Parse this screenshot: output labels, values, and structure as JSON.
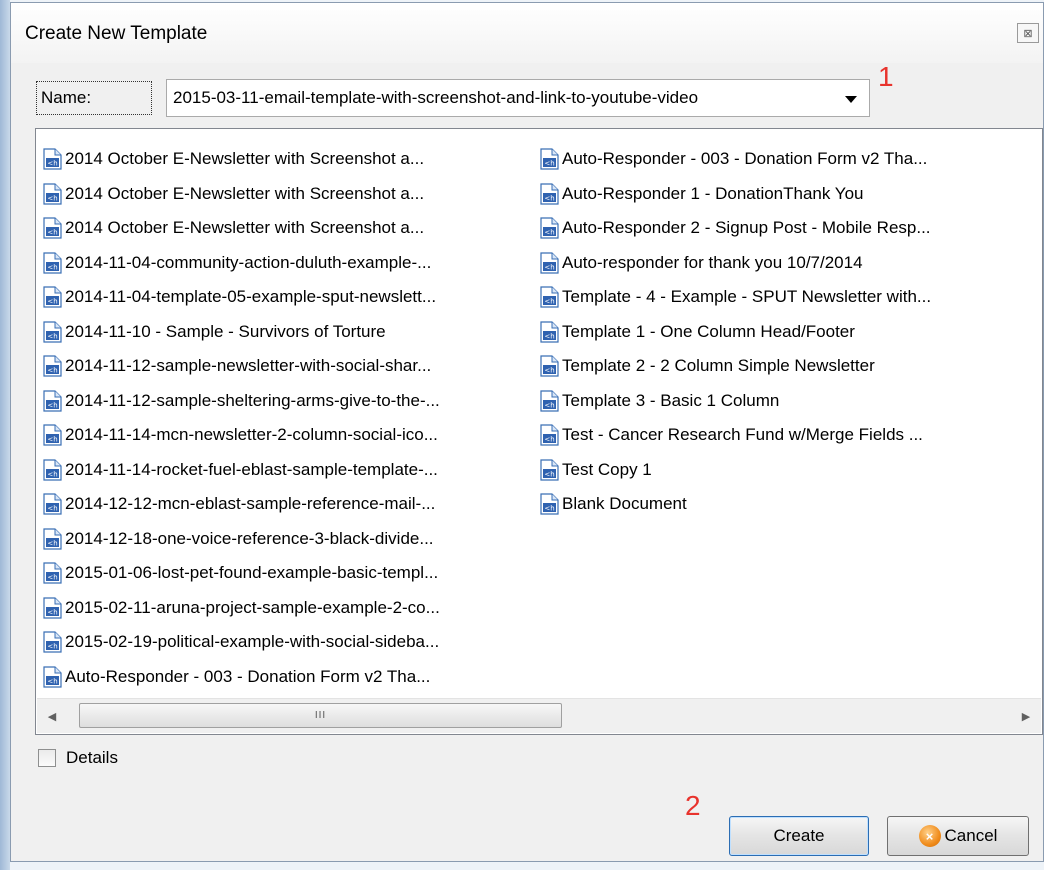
{
  "dialog": {
    "title": "Create New Template",
    "close_glyph": "⊠"
  },
  "name_field": {
    "label": "Name:",
    "value": "2015-03-11-email-template-with-screenshot-and-link-to-youtube-video"
  },
  "annotations": {
    "marker_1": "1",
    "marker_2": "2",
    "color": "#e8332d"
  },
  "templates": {
    "column_1": [
      "2014 October E-Newsletter with Screenshot a...",
      "2014 October E-Newsletter with Screenshot a...",
      "2014 October E-Newsletter with Screenshot a...",
      "2014-11-04-community-action-duluth-example-...",
      "2014-11-04-template-05-example-sput-newslett...",
      "2014-11-10 - Sample - Survivors of Torture",
      "2014-11-12-sample-newsletter-with-social-shar...",
      "2014-11-12-sample-sheltering-arms-give-to-the-...",
      "2014-11-14-mcn-newsletter-2-column-social-ico...",
      "2014-11-14-rocket-fuel-eblast-sample-template-...",
      "2014-12-12-mcn-eblast-sample-reference-mail-...",
      "2014-12-18-one-voice-reference-3-black-divide...",
      "2015-01-06-lost-pet-found-example-basic-templ...",
      "2015-02-11-aruna-project-sample-example-2-co...",
      "2015-02-19-political-example-with-social-sideba...",
      "Auto-Responder - 003 - Donation Form v2 Tha..."
    ],
    "column_2": [
      "Auto-Responder - 003 - Donation Form v2 Tha...",
      "Auto-Responder 1 - DonationThank You",
      "Auto-Responder 2 - Signup Post - Mobile Resp...",
      "Auto-responder for thank you 10/7/2014",
      "Template - 4 - Example - SPUT Newsletter with...",
      "Template 1 - One Column Head/Footer",
      "Template 2 - 2 Column Simple Newsletter",
      "Template 3 - Basic 1 Column",
      "Test - Cancer Research Fund w/Merge Fields ...",
      "Test Copy 1",
      "Blank Document"
    ],
    "item_icon": "html-document-icon"
  },
  "scrollbar": {
    "left_arrow": "◀",
    "right_arrow": "▶",
    "grip": "III"
  },
  "details": {
    "label": "Details",
    "checked": false
  },
  "buttons": {
    "create": "Create",
    "cancel": "Cancel"
  }
}
